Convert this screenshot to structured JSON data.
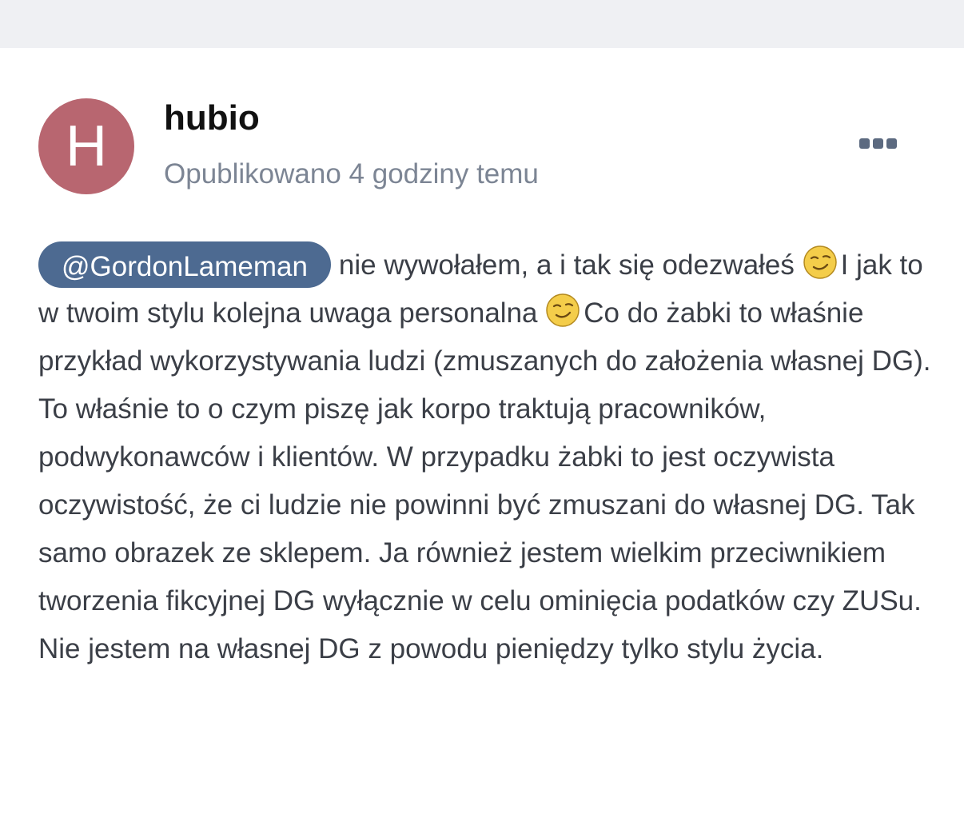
{
  "post": {
    "author": {
      "initial": "H",
      "name": "hubio",
      "avatar_color": "#b86670"
    },
    "published": "Opublikowano 4 godziny temu",
    "more_icon": "ellipsis-icon",
    "mention": "@GordonLameman",
    "text_1": "nie wywołałem, a i tak się odezwałeś",
    "text_2": "I jak to w twoim stylu kolejna uwaga personalna",
    "text_3": "Co do żabki to właśnie przykład wykorzystywania ludzi (zmuszanych do założenia własnej DG). To właśnie to o czym piszę jak korpo traktują pracowników, podwykonawców i klientów. W przypadku żabki to jest oczywista oczywistość, że ci ludzie nie powinni być zmuszani do własnej DG. Tak samo obrazek ze sklepem. Ja również jestem wielkim przeciwnikiem tworzenia fikcyjnej DG wyłącznie w celu ominięcia podatków czy ZUSu. Nie jestem na własnej DG z powodu pieniędzy tylko stylu życia.",
    "emoji_icon": "smirk-emoji-icon"
  },
  "colors": {
    "mention_bg": "#4d6a91",
    "meta_text": "#7c8594",
    "body_text": "#3b3f47",
    "top_strip": "#eff0f3"
  }
}
